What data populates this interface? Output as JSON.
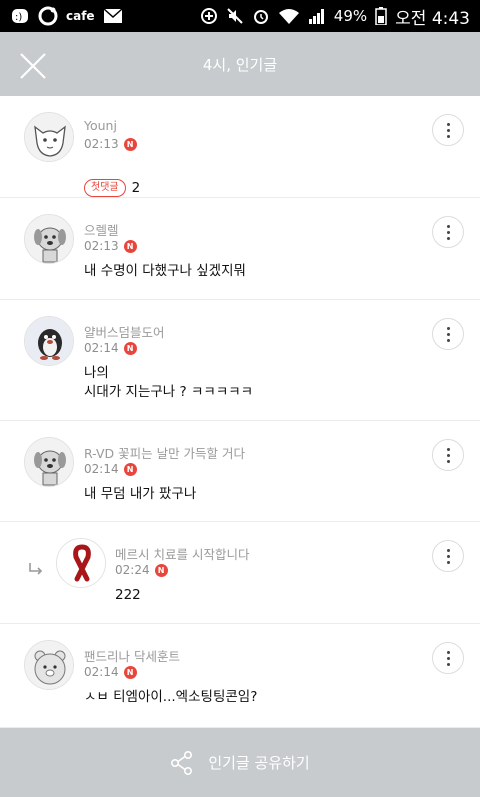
{
  "status_bar": {
    "cafe_label": "cafe",
    "battery": "49%",
    "time": "오전 4:43"
  },
  "header": {
    "title": "4시, 인기글"
  },
  "comments": [
    {
      "author": "Younj",
      "time": "02:13",
      "new_badge": "N",
      "tag": "첫댓글",
      "body": "2",
      "is_reply": false
    },
    {
      "author": "으렐렐",
      "time": "02:13",
      "new_badge": "N",
      "tag": "",
      "body": "내 수명이 다했구나 싶겠지뭐",
      "is_reply": false
    },
    {
      "author": "얄버스덤블도어",
      "time": "02:14",
      "new_badge": "N",
      "tag": "",
      "body": "나의\n시대가 지는구나 ? ㅋㅋㅋㅋㅋ",
      "is_reply": false
    },
    {
      "author": "R-VD 꽃피는 날만 가득할 거다",
      "time": "02:14",
      "new_badge": "N",
      "tag": "",
      "body": "내 무덤 내가 팠구나",
      "is_reply": false
    },
    {
      "author": "메르시 치료를 시작합니다",
      "time": "02:24",
      "new_badge": "N",
      "tag": "",
      "body": "222",
      "is_reply": true
    },
    {
      "author": "팬드리나 닥세훈트",
      "time": "02:14",
      "new_badge": "N",
      "tag": "",
      "body": "ㅅㅂ 티엠아이...엑소팅팅콘임?",
      "is_reply": false
    }
  ],
  "bottom_bar": {
    "share_label": "인기글 공유하기"
  },
  "colors": {
    "header_bg": "#c7cbcd",
    "badge_red": "#e8453c"
  }
}
